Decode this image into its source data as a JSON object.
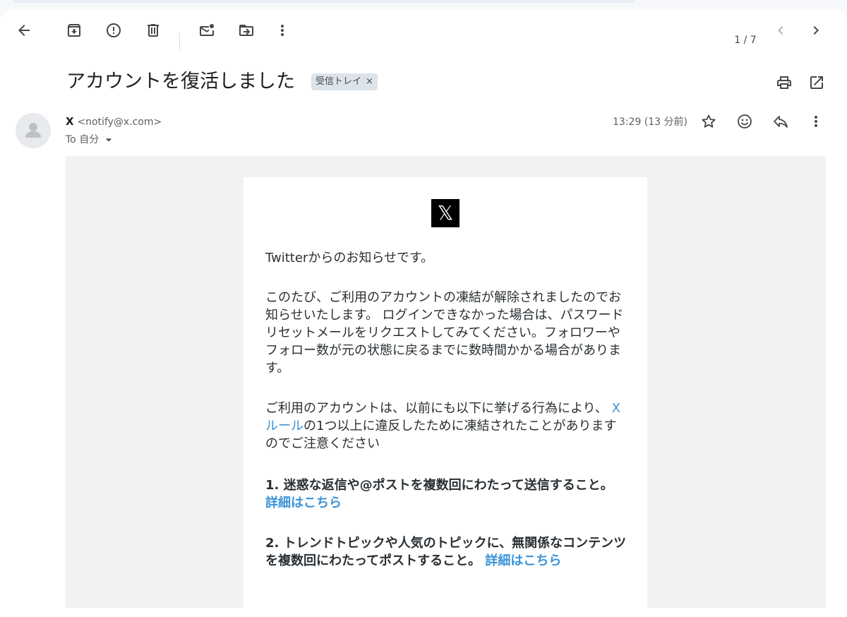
{
  "toolbar": {
    "pager": "1 / 7"
  },
  "message": {
    "subject": "アカウントを復活しました",
    "label": "受信トレイ",
    "label_remove": "×",
    "sender_name": "X",
    "sender_email": "<notify@x.com>",
    "to": "To 自分",
    "time": "13:29 (13 分前)"
  },
  "email_body": {
    "logo_glyph": "𝕏",
    "greeting": "Twitterからのお知らせです。",
    "para1": "このたび、ご利用のアカウントの凍結が解除されましたのでお知らせいたします。 ログインできなかった場合は、パスワードリセットメールをリクエストしてみてください。フォロワーやフォロー数が元の状態に戻るまでに数時間かかる場合があります。",
    "para2_prefix": "ご利用のアカウントは、以前にも以下に挙げる行為により、 ",
    "para2_link": "Xルール",
    "para2_suffix": "の1つ以上に違反したために凍結されたことがありますのでご注意ください",
    "item1_text": "1. 迷惑な返信や@ポストを複数回にわたって送信すること。 ",
    "item1_link": "詳細はこちら",
    "item2_text": "2. トレンドトピックや人気のトピックに、無関係なコンテンツを複数回にわたってポストすること。 ",
    "item2_link": "詳細はこちら"
  },
  "icons": {
    "back": "arrow-back-icon",
    "archive": "archive-icon",
    "spam": "report-spam-icon",
    "delete": "trash-icon",
    "unread": "mark-unread-icon",
    "move": "move-to-icon",
    "more": "more-vert-icon",
    "prev": "chevron-left-icon",
    "next": "chevron-right-icon",
    "print": "print-icon",
    "open": "open-new-window-icon",
    "star": "star-icon",
    "emoji": "emoji-icon",
    "reply": "reply-icon"
  },
  "colors": {
    "link": "#3b94d9",
    "chip": "#dde3ea"
  }
}
